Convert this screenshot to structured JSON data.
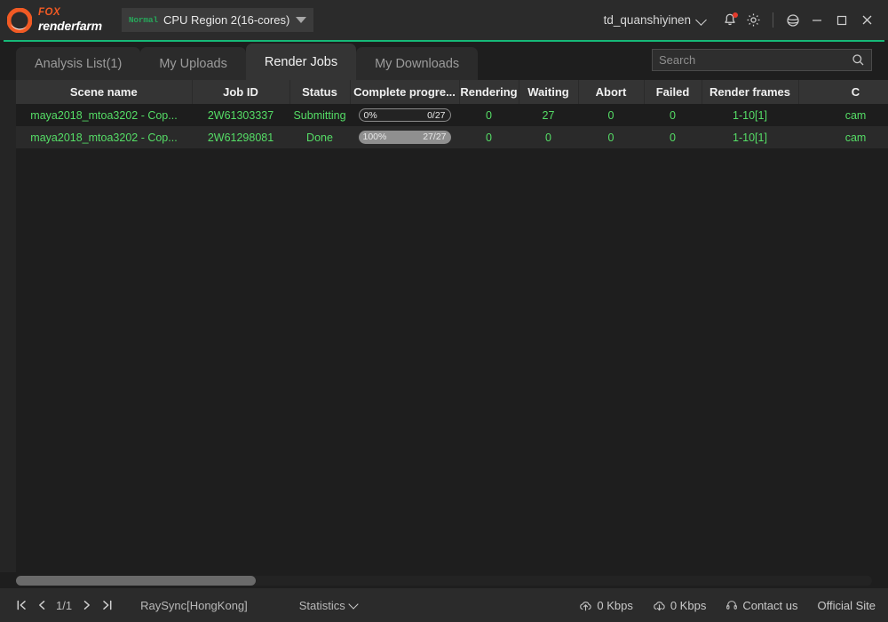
{
  "titlebar": {
    "logo": {
      "brand_top": "FOX",
      "brand_bottom": "renderfarm",
      "mark_icon": "fox-logo-icon",
      "color": "#f15a24"
    },
    "region": {
      "badge": "Normal",
      "label": "CPU Region 2(16-cores)",
      "chevron_icon": "triangle-down-icon"
    },
    "user": {
      "name": "td_quanshiyinen",
      "chevron_icon": "chevron-down-icon"
    },
    "icons": {
      "bell": "bell-icon",
      "bell_has_badge": true,
      "gear": "gear-icon",
      "globe": "globe-icon",
      "minimize": "minimize-icon",
      "maximize": "maximize-icon",
      "close": "close-icon"
    },
    "accent_rule_color": "#16b978"
  },
  "tabs": [
    {
      "label": "Analysis List(1)",
      "active": false
    },
    {
      "label": "My Uploads",
      "active": false
    },
    {
      "label": "Render Jobs",
      "active": true
    },
    {
      "label": "My Downloads",
      "active": false
    }
  ],
  "search": {
    "value": "",
    "placeholder": "Search",
    "icon": "search-icon"
  },
  "table": {
    "columns": [
      "Scene name",
      "Job ID",
      "Status",
      "Complete progre...",
      "Rendering",
      "Waiting",
      "Abort",
      "Failed",
      "Render frames",
      "C"
    ],
    "rows": [
      {
        "scene_name": "maya2018_mtoa3202 - Cop...",
        "job_id": "2W61303337",
        "status": "Submitting",
        "progress_pct": "0%",
        "progress_frac": "0/27",
        "progress_value": 0,
        "rendering": "0",
        "waiting": "27",
        "abort": "0",
        "failed": "0",
        "render_frames": "1-10[1]",
        "camera": "cam"
      },
      {
        "scene_name": "maya2018_mtoa3202 - Cop...",
        "job_id": "2W61298081",
        "status": "Done",
        "progress_pct": "100%",
        "progress_frac": "27/27",
        "progress_value": 100,
        "rendering": "0",
        "waiting": "0",
        "abort": "0",
        "failed": "0",
        "render_frames": "1-10[1]",
        "camera": "cam"
      }
    ],
    "row_text_color": "#55dd66"
  },
  "statusbar": {
    "pager": {
      "first_icon": "go-first-icon",
      "prev_icon": "go-prev-icon",
      "page_label": "1/1",
      "next_icon": "go-next-icon",
      "last_icon": "go-last-icon"
    },
    "raysync": "RaySync[HongKong]",
    "statistics": "Statistics",
    "upload_speed": "0 Kbps",
    "download_speed": "0 Kbps",
    "contact": "Contact us",
    "official": "Official Site",
    "icons": {
      "upload": "cloud-upload-icon",
      "download": "cloud-download-icon",
      "headset": "headset-icon",
      "statistics_chevron": "chevron-down-icon"
    }
  }
}
